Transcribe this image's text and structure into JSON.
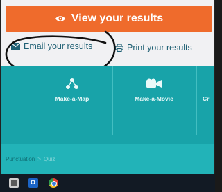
{
  "results": {
    "view_label": "View your results",
    "email_label": "Email your results",
    "print_label": "Print your results"
  },
  "tools": [
    {
      "label": "Make-a-Map",
      "icon": "map-nodes-icon"
    },
    {
      "label": "Make-a-Movie",
      "icon": "movie-camera-icon"
    },
    {
      "label": "Cr",
      "icon": ""
    }
  ],
  "breadcrumb": {
    "parent": "Punctuation",
    "separator": ">",
    "current": "Quiz"
  },
  "taskbar": {
    "apps": [
      "store-icon",
      "outlook-icon",
      "chrome-icon"
    ]
  },
  "colors": {
    "accent_orange": "#ef6b2c",
    "teal": "#18a3a9",
    "link_blue": "#1e5f73"
  }
}
